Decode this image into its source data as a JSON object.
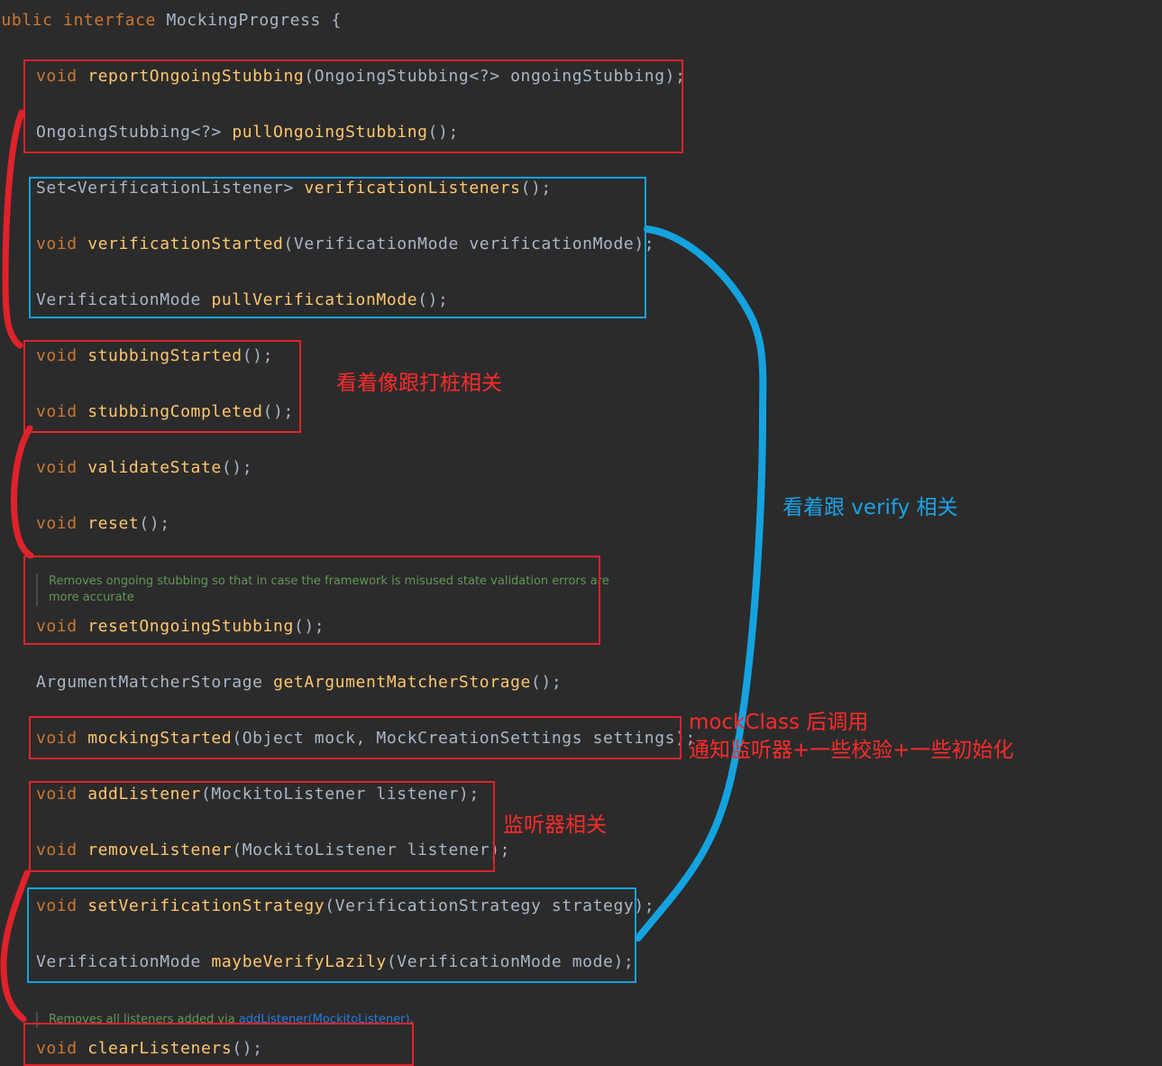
{
  "header": {
    "kw": "public interface",
    "name": "MockingProgress",
    "brace": "{"
  },
  "lines": {
    "l1": {
      "kw": "void",
      "fn": "reportOngoingStubbing",
      "rest": "(OngoingStubbing<?> ongoingStubbing);"
    },
    "l2": {
      "type": "OngoingStubbing<?>",
      "fn": "pullOngoingStubbing",
      "rest": "();"
    },
    "l3": {
      "type": "Set<VerificationListener>",
      "fn": "verificationListeners",
      "rest": "();"
    },
    "l4": {
      "kw": "void",
      "fn": "verificationStarted",
      "rest": "(VerificationMode verificationMode);"
    },
    "l5": {
      "type": "VerificationMode",
      "fn": "pullVerificationMode",
      "rest": "();"
    },
    "l6": {
      "kw": "void",
      "fn": "stubbingStarted",
      "rest": "();"
    },
    "l7": {
      "kw": "void",
      "fn": "stubbingCompleted",
      "rest": "();"
    },
    "l8": {
      "kw": "void",
      "fn": "validateState",
      "rest": "();"
    },
    "l9": {
      "kw": "void",
      "fn": "reset",
      "rest": "();"
    },
    "l10": {
      "kw": "void",
      "fn": "resetOngoingStubbing",
      "rest": "();"
    },
    "l11": {
      "type": "ArgumentMatcherStorage",
      "fn": "getArgumentMatcherStorage",
      "rest": "();"
    },
    "l12": {
      "kw": "void",
      "fn": "mockingStarted",
      "rest": "(Object mock, MockCreationSettings settings);"
    },
    "l13": {
      "kw": "void",
      "fn": "addListener",
      "rest": "(MockitoListener listener);"
    },
    "l14": {
      "kw": "void",
      "fn": "removeListener",
      "rest": "(MockitoListener listener);"
    },
    "l15": {
      "kw": "void",
      "fn": "setVerificationStrategy",
      "rest": "(VerificationStrategy strategy);"
    },
    "l16": {
      "type": "VerificationMode",
      "fn": "maybeVerifyLazily",
      "rest": "(VerificationMode mode);"
    },
    "l17": {
      "kw": "void",
      "fn": "clearListeners",
      "rest": "();"
    }
  },
  "docs": {
    "reset_ongoing_1": "Removes ongoing stubbing so that in case the framework is misused state validation errors are",
    "reset_ongoing_2": "more accurate",
    "clear_prefix": "Removes all listeners added via ",
    "clear_link": "addListener(MockitoListener)",
    "clear_suffix": "."
  },
  "annotations": {
    "stubbing": "看着像跟打桩相关",
    "verify": "看着跟 verify 相关",
    "mocking_1": "mockClass 后调用",
    "mocking_2": "通知监听器+一些校验+一些初始化",
    "listener": "监听器相关"
  },
  "colors": {
    "background": "#2b2b2b",
    "keyword": "#cc7832",
    "method": "#ffc66d",
    "text": "#a9b7c6",
    "doc": "#629755",
    "annotation_red": "#e0222b",
    "annotation_blue": "#14a3e0"
  }
}
